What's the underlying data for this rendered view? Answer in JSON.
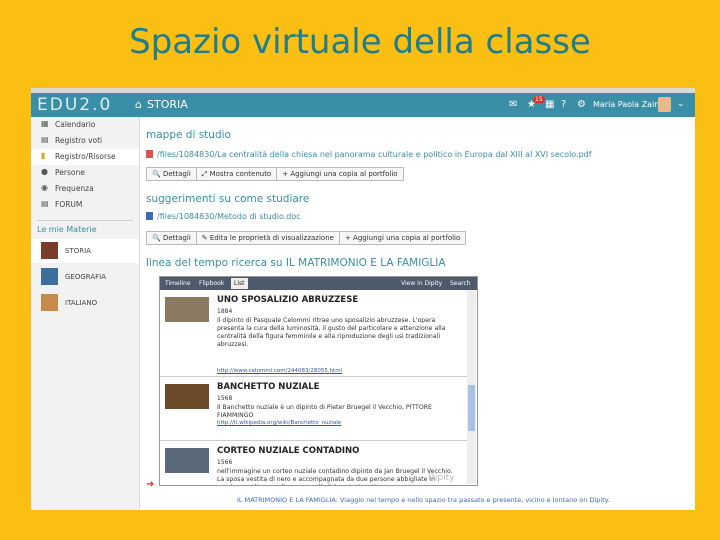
{
  "slide": {
    "title": "Spazio virtuale della classe"
  },
  "topbar": {
    "logo": "EDU2.0",
    "breadcrumb": "STORIA",
    "notification_count": "15",
    "user_name": "Maria Paola Zaino"
  },
  "sidebar": {
    "items": [
      {
        "label": "Calendario",
        "icon": "calendar-icon"
      },
      {
        "label": "Registro voti",
        "icon": "grades-icon"
      },
      {
        "label": "Registro/Risorse",
        "icon": "resources-icon"
      },
      {
        "label": "Persone",
        "icon": "person-icon"
      },
      {
        "label": "Frequenza",
        "icon": "attendance-icon"
      },
      {
        "label": "FORUM",
        "icon": "forum-icon"
      }
    ],
    "subjects_heading": "Le mie Materie",
    "subjects": [
      {
        "label": "STORIA"
      },
      {
        "label": "GEOGRAFIA"
      },
      {
        "label": "ITALIANO"
      }
    ]
  },
  "main": {
    "sections": [
      {
        "title": "mappe di studio",
        "file": "/files/1084830/La centralità della chiesa nel panorama culturale e politico in Europa dal XIII al XVI secolo.pdf",
        "buttons": [
          "Dettagli",
          "Mostra contenuto",
          "Aggiungi una copia al portfolio"
        ]
      },
      {
        "title": "suggerimenti su come studiare",
        "file": "/files/1084830/Metodo di studio.doc",
        "buttons": [
          "Dettagli",
          "Edita le proprietà di visualizzazione",
          "Aggiungi una copia al portfolio"
        ]
      },
      {
        "title": "linea del tempo ricerca su IL MATRIMONIO E LA FAMIGLIA"
      }
    ]
  },
  "timeline": {
    "tabs": [
      "Timeline",
      "Flipbook",
      "List"
    ],
    "active_tab": "List",
    "right_links": [
      "View in Dipity",
      "Search"
    ],
    "entries": [
      {
        "title": "UNO SPOSALIZIO ABRUZZESE",
        "year": "1884",
        "description": "il dipinto di Pasquale Celommi ritrae uno sposalizio abruzzese. L'opera presenta la cura della luminosità, il gusto del particolare e attenzione alla centralità della figura femminile e alla riproduzione degli usi tradizionali abruzzesi.",
        "link": "http://www.celommi.com/244083/28055.html"
      },
      {
        "title": "BANCHETTO NUZIALE",
        "year": "1568",
        "description": "Il Banchetto nuziale è un dipinto di Pieter Bruegel il Vecchio, PITTORE FIAMMINGO",
        "link": "http://it.wikipedia.org/wiki/Banchetto_nuziale"
      },
      {
        "title": "CORTEO NUZIALE CONTADINO",
        "year": "1566",
        "description": "nell'immagine un corteo nuziale contadino dipinto da Jan Bruegel il Vecchio. La sposa vestita di nero e accompagnata da due persone abbigliate in maniera molto semplice, come gli altri partecipanti."
      }
    ],
    "watermark": "Dipity",
    "caption": "IL MATRIMONIO E LA FAMIGLIA: Viaggio nel tempo e nello spazio tra passato e presente, vicino e lontano on Dipity."
  }
}
